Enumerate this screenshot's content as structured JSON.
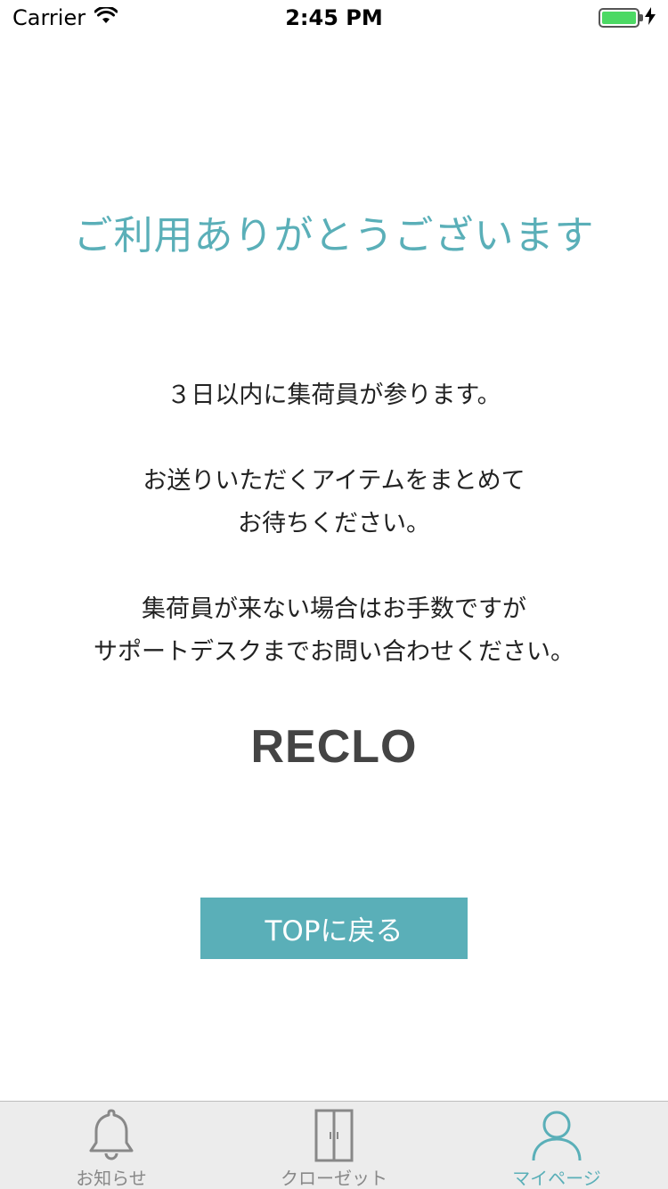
{
  "status_bar": {
    "carrier": "Carrier",
    "time": "2:45 PM"
  },
  "heading": "ご利用ありがとうございます",
  "message": {
    "line1": "３日以内に集荷員が参ります。",
    "line2a": "お送りいただくアイテムをまとめて",
    "line2b": "お待ちください。",
    "line3a": "集荷員が来ない場合はお手数ですが",
    "line3b": "サポートデスクまでお問い合わせください。"
  },
  "brand": "RECLO",
  "top_button_label": "TOPに戻る",
  "tab_bar": {
    "tabs": [
      {
        "label": "お知らせ",
        "icon": "bell-icon"
      },
      {
        "label": "クローゼット",
        "icon": "closet-icon"
      },
      {
        "label": "マイページ",
        "icon": "person-icon"
      }
    ],
    "active_index": 2
  },
  "colors": {
    "accent": "#5aafb8",
    "battery": "#4cd964"
  }
}
